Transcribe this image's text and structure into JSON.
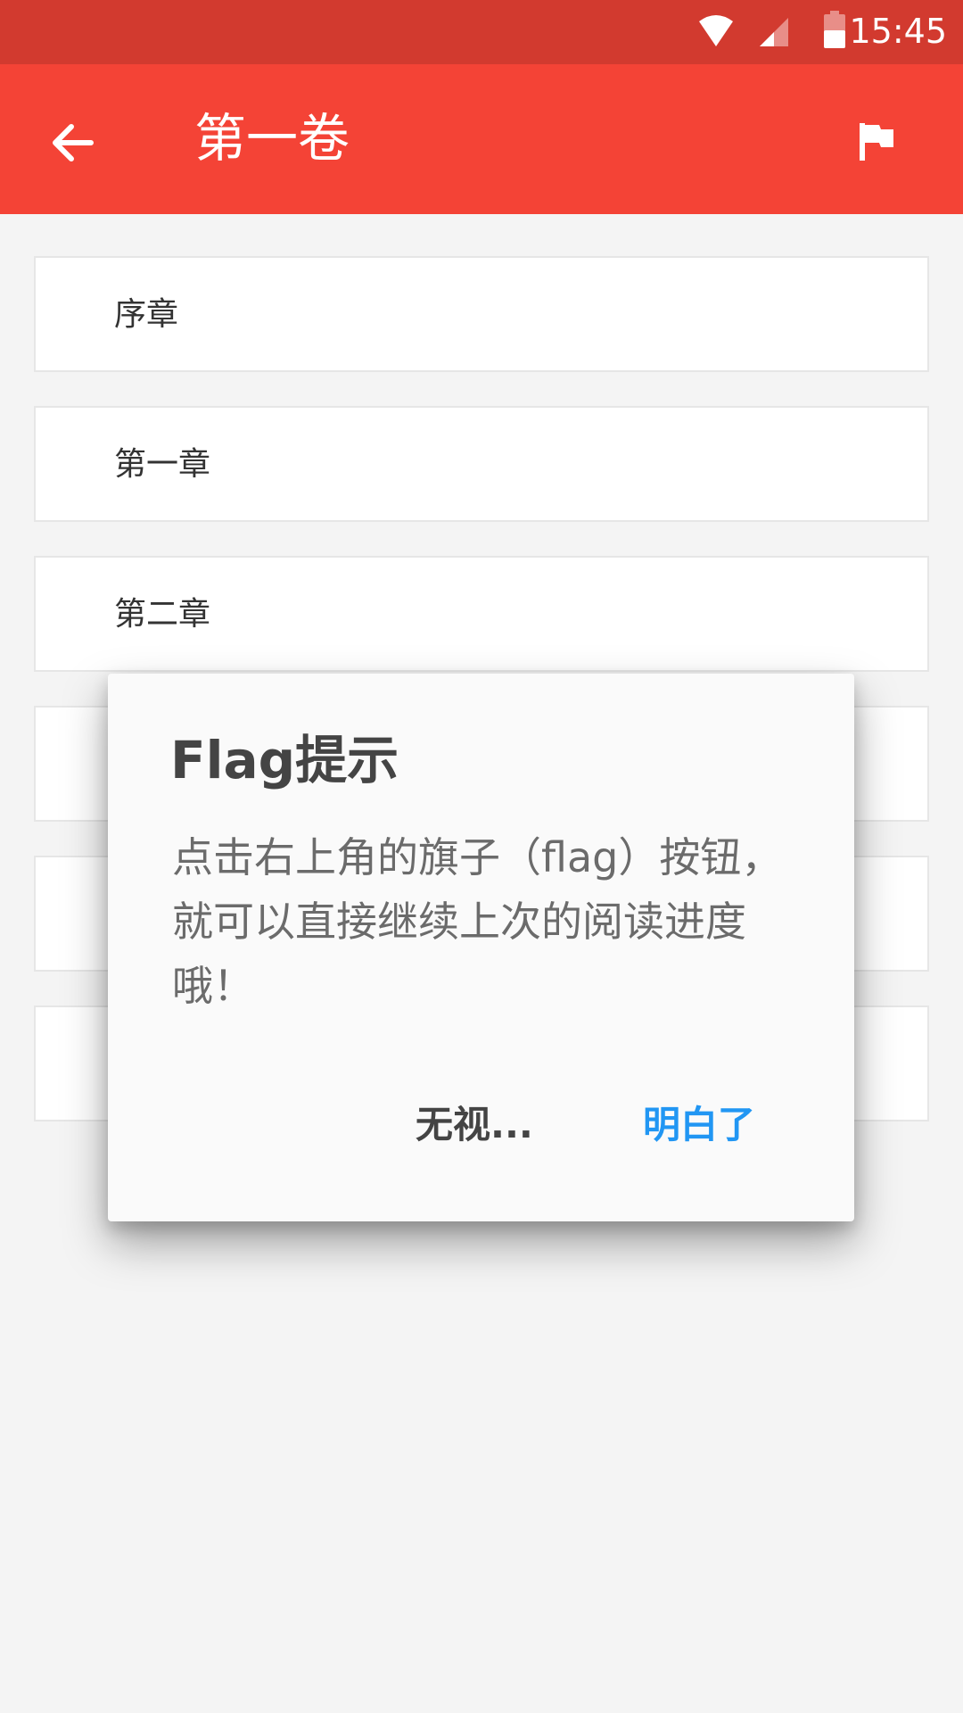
{
  "status_bar": {
    "time": "15:45",
    "icons": [
      "wifi-icon",
      "cell-signal-icon",
      "battery-icon"
    ]
  },
  "app_bar": {
    "title": "第一卷",
    "back_icon": "arrow-back-icon",
    "action_icon": "flag-icon",
    "color": "#f44336"
  },
  "chapters": [
    {
      "label": "序章"
    },
    {
      "label": "第一章"
    },
    {
      "label": "第二章"
    },
    {
      "label": ""
    },
    {
      "label": ""
    },
    {
      "label": ""
    }
  ],
  "dialog": {
    "title": "Flag提示",
    "message": "点击右上角的旗子（flag）按钮，就可以直接继续上次的阅读进度哦！",
    "ignore_label": "无视...",
    "ok_label": "明白了",
    "ok_color": "#2196f3"
  }
}
